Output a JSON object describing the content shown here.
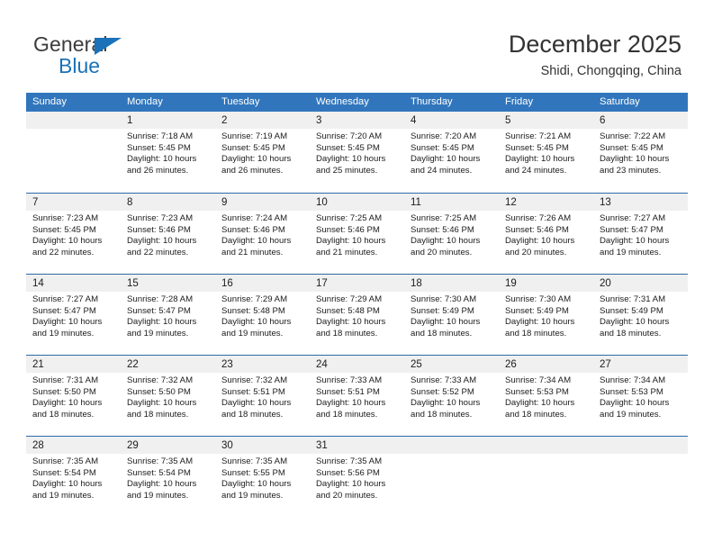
{
  "brand": {
    "name_top": "General",
    "name_bottom": "Blue",
    "triangle_icon": "triangle-icon",
    "color_dark": "#3c3c3c",
    "color_blue": "#1b72b8"
  },
  "header": {
    "title": "December 2025",
    "subtitle": "Shidi, Chongqing, China"
  },
  "colors": {
    "header_blue": "#3176bc",
    "row_divider": "#2d6aa8",
    "day_band": "#f0f0f0"
  },
  "weekdays": [
    "Sunday",
    "Monday",
    "Tuesday",
    "Wednesday",
    "Thursday",
    "Friday",
    "Saturday"
  ],
  "weeks": [
    [
      {
        "day": "",
        "lines": []
      },
      {
        "day": "1",
        "lines": [
          "Sunrise: 7:18 AM",
          "Sunset: 5:45 PM",
          "Daylight: 10 hours",
          "and 26 minutes."
        ]
      },
      {
        "day": "2",
        "lines": [
          "Sunrise: 7:19 AM",
          "Sunset: 5:45 PM",
          "Daylight: 10 hours",
          "and 26 minutes."
        ]
      },
      {
        "day": "3",
        "lines": [
          "Sunrise: 7:20 AM",
          "Sunset: 5:45 PM",
          "Daylight: 10 hours",
          "and 25 minutes."
        ]
      },
      {
        "day": "4",
        "lines": [
          "Sunrise: 7:20 AM",
          "Sunset: 5:45 PM",
          "Daylight: 10 hours",
          "and 24 minutes."
        ]
      },
      {
        "day": "5",
        "lines": [
          "Sunrise: 7:21 AM",
          "Sunset: 5:45 PM",
          "Daylight: 10 hours",
          "and 24 minutes."
        ]
      },
      {
        "day": "6",
        "lines": [
          "Sunrise: 7:22 AM",
          "Sunset: 5:45 PM",
          "Daylight: 10 hours",
          "and 23 minutes."
        ]
      }
    ],
    [
      {
        "day": "7",
        "lines": [
          "Sunrise: 7:23 AM",
          "Sunset: 5:45 PM",
          "Daylight: 10 hours",
          "and 22 minutes."
        ]
      },
      {
        "day": "8",
        "lines": [
          "Sunrise: 7:23 AM",
          "Sunset: 5:46 PM",
          "Daylight: 10 hours",
          "and 22 minutes."
        ]
      },
      {
        "day": "9",
        "lines": [
          "Sunrise: 7:24 AM",
          "Sunset: 5:46 PM",
          "Daylight: 10 hours",
          "and 21 minutes."
        ]
      },
      {
        "day": "10",
        "lines": [
          "Sunrise: 7:25 AM",
          "Sunset: 5:46 PM",
          "Daylight: 10 hours",
          "and 21 minutes."
        ]
      },
      {
        "day": "11",
        "lines": [
          "Sunrise: 7:25 AM",
          "Sunset: 5:46 PM",
          "Daylight: 10 hours",
          "and 20 minutes."
        ]
      },
      {
        "day": "12",
        "lines": [
          "Sunrise: 7:26 AM",
          "Sunset: 5:46 PM",
          "Daylight: 10 hours",
          "and 20 minutes."
        ]
      },
      {
        "day": "13",
        "lines": [
          "Sunrise: 7:27 AM",
          "Sunset: 5:47 PM",
          "Daylight: 10 hours",
          "and 19 minutes."
        ]
      }
    ],
    [
      {
        "day": "14",
        "lines": [
          "Sunrise: 7:27 AM",
          "Sunset: 5:47 PM",
          "Daylight: 10 hours",
          "and 19 minutes."
        ]
      },
      {
        "day": "15",
        "lines": [
          "Sunrise: 7:28 AM",
          "Sunset: 5:47 PM",
          "Daylight: 10 hours",
          "and 19 minutes."
        ]
      },
      {
        "day": "16",
        "lines": [
          "Sunrise: 7:29 AM",
          "Sunset: 5:48 PM",
          "Daylight: 10 hours",
          "and 19 minutes."
        ]
      },
      {
        "day": "17",
        "lines": [
          "Sunrise: 7:29 AM",
          "Sunset: 5:48 PM",
          "Daylight: 10 hours",
          "and 18 minutes."
        ]
      },
      {
        "day": "18",
        "lines": [
          "Sunrise: 7:30 AM",
          "Sunset: 5:49 PM",
          "Daylight: 10 hours",
          "and 18 minutes."
        ]
      },
      {
        "day": "19",
        "lines": [
          "Sunrise: 7:30 AM",
          "Sunset: 5:49 PM",
          "Daylight: 10 hours",
          "and 18 minutes."
        ]
      },
      {
        "day": "20",
        "lines": [
          "Sunrise: 7:31 AM",
          "Sunset: 5:49 PM",
          "Daylight: 10 hours",
          "and 18 minutes."
        ]
      }
    ],
    [
      {
        "day": "21",
        "lines": [
          "Sunrise: 7:31 AM",
          "Sunset: 5:50 PM",
          "Daylight: 10 hours",
          "and 18 minutes."
        ]
      },
      {
        "day": "22",
        "lines": [
          "Sunrise: 7:32 AM",
          "Sunset: 5:50 PM",
          "Daylight: 10 hours",
          "and 18 minutes."
        ]
      },
      {
        "day": "23",
        "lines": [
          "Sunrise: 7:32 AM",
          "Sunset: 5:51 PM",
          "Daylight: 10 hours",
          "and 18 minutes."
        ]
      },
      {
        "day": "24",
        "lines": [
          "Sunrise: 7:33 AM",
          "Sunset: 5:51 PM",
          "Daylight: 10 hours",
          "and 18 minutes."
        ]
      },
      {
        "day": "25",
        "lines": [
          "Sunrise: 7:33 AM",
          "Sunset: 5:52 PM",
          "Daylight: 10 hours",
          "and 18 minutes."
        ]
      },
      {
        "day": "26",
        "lines": [
          "Sunrise: 7:34 AM",
          "Sunset: 5:53 PM",
          "Daylight: 10 hours",
          "and 18 minutes."
        ]
      },
      {
        "day": "27",
        "lines": [
          "Sunrise: 7:34 AM",
          "Sunset: 5:53 PM",
          "Daylight: 10 hours",
          "and 19 minutes."
        ]
      }
    ],
    [
      {
        "day": "28",
        "lines": [
          "Sunrise: 7:35 AM",
          "Sunset: 5:54 PM",
          "Daylight: 10 hours",
          "and 19 minutes."
        ]
      },
      {
        "day": "29",
        "lines": [
          "Sunrise: 7:35 AM",
          "Sunset: 5:54 PM",
          "Daylight: 10 hours",
          "and 19 minutes."
        ]
      },
      {
        "day": "30",
        "lines": [
          "Sunrise: 7:35 AM",
          "Sunset: 5:55 PM",
          "Daylight: 10 hours",
          "and 19 minutes."
        ]
      },
      {
        "day": "31",
        "lines": [
          "Sunrise: 7:35 AM",
          "Sunset: 5:56 PM",
          "Daylight: 10 hours",
          "and 20 minutes."
        ]
      },
      {
        "day": "",
        "lines": []
      },
      {
        "day": "",
        "lines": []
      },
      {
        "day": "",
        "lines": []
      }
    ]
  ]
}
